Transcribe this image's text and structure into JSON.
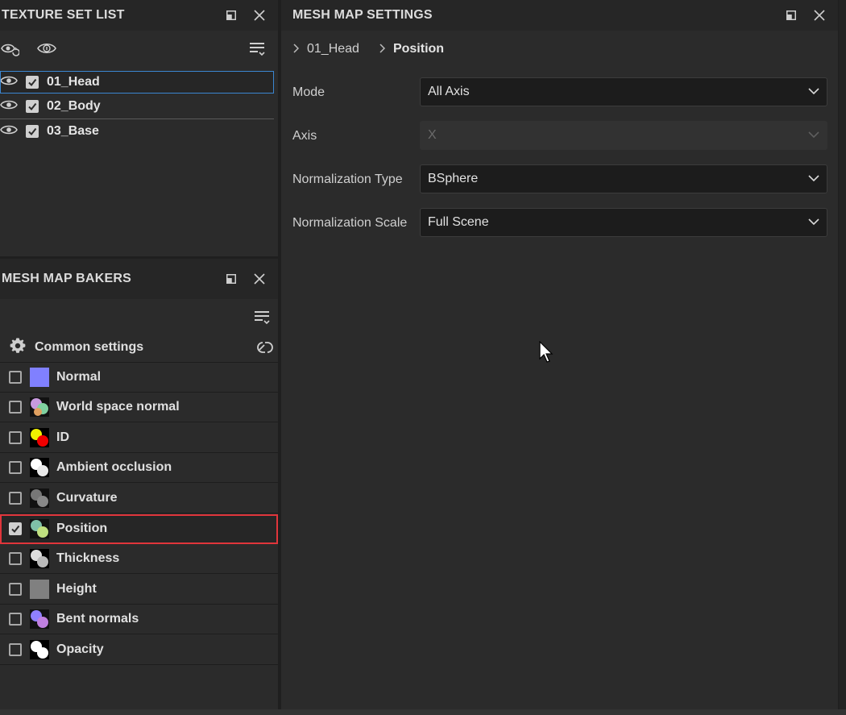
{
  "texture_set_list": {
    "title": "TEXTURE SET LIST",
    "items": [
      {
        "label": "01_Head",
        "checked": true,
        "selected": true
      },
      {
        "label": "02_Body",
        "checked": true,
        "selected": false
      },
      {
        "label": "03_Base",
        "checked": true,
        "selected": false
      }
    ]
  },
  "mesh_map_bakers": {
    "title": "MESH MAP BAKERS",
    "common_settings": "Common settings",
    "items": [
      {
        "label": "Normal",
        "checked": false,
        "thumb": "normal-map-thumbnail"
      },
      {
        "label": "World space normal",
        "checked": false,
        "thumb": "world-space-normal-thumbnail"
      },
      {
        "label": "ID",
        "checked": false,
        "thumb": "id-map-thumbnail"
      },
      {
        "label": "Ambient occlusion",
        "checked": false,
        "thumb": "ambient-occlusion-thumbnail"
      },
      {
        "label": "Curvature",
        "checked": false,
        "thumb": "curvature-thumbnail"
      },
      {
        "label": "Position",
        "checked": true,
        "thumb": "position-thumbnail",
        "highlighted": true
      },
      {
        "label": "Thickness",
        "checked": false,
        "thumb": "thickness-thumbnail"
      },
      {
        "label": "Height",
        "checked": false,
        "thumb": "height-thumbnail"
      },
      {
        "label": "Bent normals",
        "checked": false,
        "thumb": "bent-normals-thumbnail"
      },
      {
        "label": "Opacity",
        "checked": false,
        "thumb": "opacity-thumbnail"
      }
    ]
  },
  "mesh_map_settings": {
    "title": "MESH MAP SETTINGS",
    "breadcrumb": [
      "01_Head",
      "Position"
    ],
    "fields": [
      {
        "label": "Mode",
        "value": "All Axis",
        "disabled": false
      },
      {
        "label": "Axis",
        "value": "X",
        "disabled": true
      },
      {
        "label": "Normalization Type",
        "value": "BSphere",
        "disabled": false
      },
      {
        "label": "Normalization Scale",
        "value": "Full Scene",
        "disabled": false
      }
    ]
  },
  "colors": {
    "panel_bg": "#2b2b2b",
    "header_bg": "#262626",
    "selection_outline": "#3b86d1",
    "highlight_outline": "#e0353b"
  }
}
